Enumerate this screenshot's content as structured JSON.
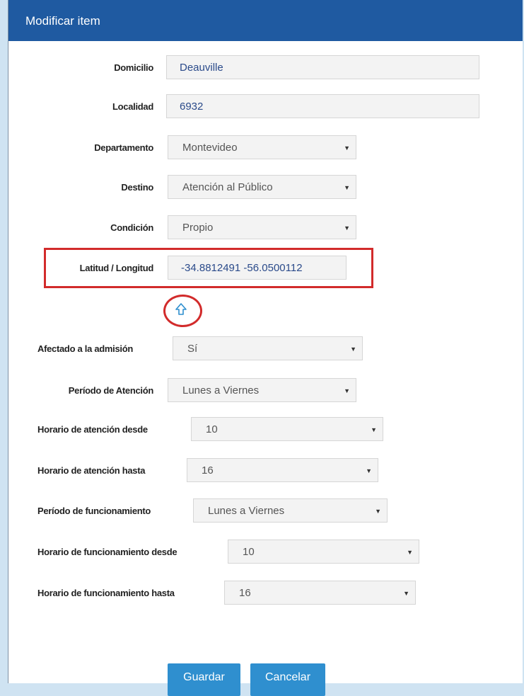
{
  "dialog": {
    "title": "Modificar item"
  },
  "form": {
    "domicilio": {
      "label": "Domicilio",
      "value": "Deauville"
    },
    "localidad": {
      "label": "Localidad",
      "value": "6932"
    },
    "departamento": {
      "label": "Departamento",
      "value": "Montevideo"
    },
    "destino": {
      "label": "Destino",
      "value": "Atención al Público"
    },
    "condicion": {
      "label": "Condición",
      "value": "Propio"
    },
    "latlong": {
      "label": "Latitud / Longitud",
      "value": "-34.8812491 -56.0500112"
    },
    "afectado": {
      "label": "Afectado a la admisión",
      "value": "Sí"
    },
    "periodo_atencion": {
      "label": "Período de Atención",
      "value": "Lunes a Viernes"
    },
    "horario_atencion_desde": {
      "label": "Horario de atención desde",
      "value": "10"
    },
    "horario_atencion_hasta": {
      "label": "Horario de atención hasta",
      "value": "16"
    },
    "periodo_funcionamiento": {
      "label": "Período de funcionamiento",
      "value": "Lunes a Viernes"
    },
    "horario_func_desde": {
      "label": "Horario de funcionamiento desde",
      "value": "10"
    },
    "horario_func_hasta": {
      "label": "Horario de funcionamiento hasta",
      "value": "16"
    }
  },
  "buttons": {
    "save": "Guardar",
    "cancel": "Cancelar"
  },
  "icons": {
    "dropdown": "chevron-down-icon",
    "locate": "up-arrow-icon"
  },
  "colors": {
    "title_bar": "#1f5aa1",
    "button": "#2f8fcf",
    "highlight": "#d22b2b"
  }
}
